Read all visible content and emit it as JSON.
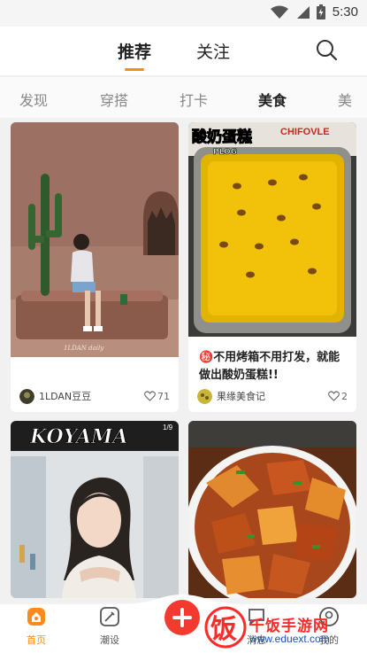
{
  "status_bar": {
    "time": "5:30"
  },
  "header": {
    "tabs": [
      {
        "label": "推荐",
        "active": true
      },
      {
        "label": "关注",
        "active": false
      }
    ]
  },
  "categories": [
    {
      "label": "发现",
      "active": false
    },
    {
      "label": "穿搭",
      "active": false
    },
    {
      "label": "打卡",
      "active": false
    },
    {
      "label": "美食",
      "active": true
    },
    {
      "label": "美",
      "active": false
    }
  ],
  "feed": [
    {
      "title": "",
      "author": "1LDAN豆豆",
      "likes": "71",
      "image_caption": "1LDAN daily"
    },
    {
      "image_title": "酸奶蛋糕",
      "image_subtitle": "PLOG",
      "image_brand": "CHIFOVLE",
      "title": "㊙️不用烤箱不用打发，就能做出酸奶蛋糕!!",
      "author": "果缘美食记",
      "likes": "2"
    },
    {
      "image_title": "KOYAMA",
      "image_badge": "1/9"
    },
    {}
  ],
  "bottom_nav": [
    {
      "label": "首页",
      "icon": "home-icon",
      "active": true
    },
    {
      "label": "潮设",
      "icon": "design-icon",
      "active": false
    },
    {
      "label": "消息",
      "icon": "message-icon",
      "active": false
    },
    {
      "label": "我的",
      "icon": "profile-icon",
      "active": false
    }
  ],
  "watermark": {
    "text": "千饭手游网",
    "url": "www.eduext.com",
    "logo_char": "饭"
  },
  "colors": {
    "accent": "#ff8a1c",
    "add_button": "#f33a2e"
  }
}
